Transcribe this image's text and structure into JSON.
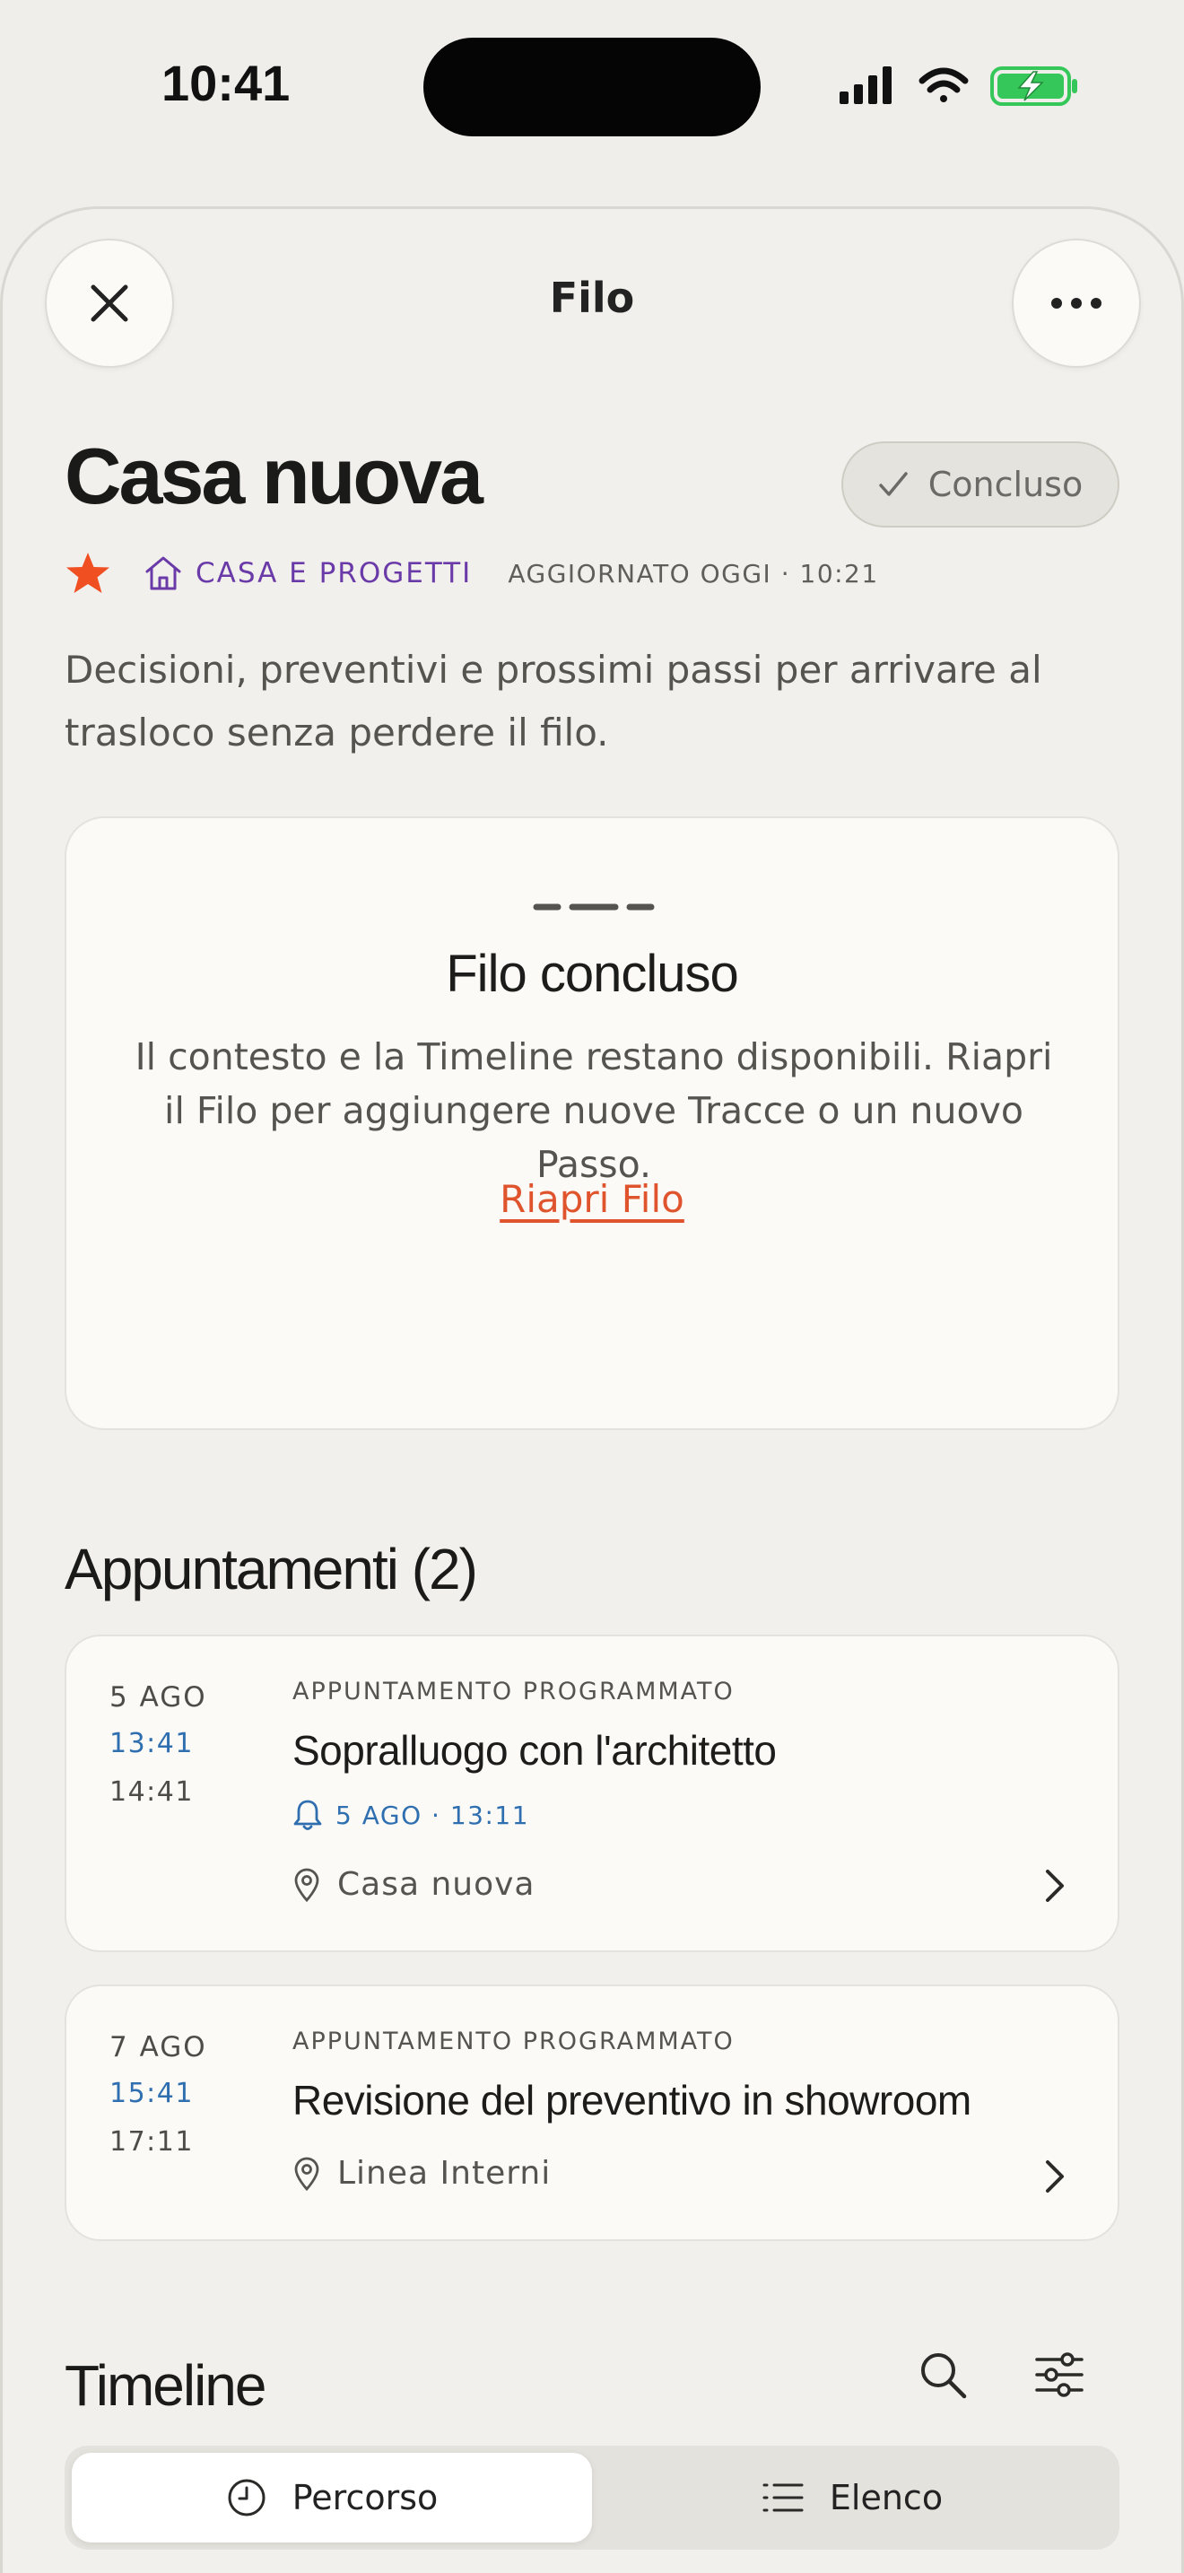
{
  "status_bar": {
    "time": "10:41"
  },
  "sheet": {
    "title": "Filo"
  },
  "thread": {
    "title": "Casa nuova",
    "status_label": "Concluso",
    "category": "CASA E PROGETTI",
    "updated": "AGGIORNATO OGGI · 10:21",
    "description": "Decisioni, preventivi e prossimi passi per arrivare al trasloco senza perdere il filo."
  },
  "closed_card": {
    "title": "Filo concluso",
    "text": "Il contesto e la Timeline restano disponibili. Riapri il Filo per aggiungere nuove Tracce o un nuovo Passo.",
    "reopen_label": "Riapri Filo"
  },
  "appointments": {
    "title": "Appuntamenti (2)",
    "items": [
      {
        "date": "5 AGO",
        "start": "13:41",
        "end": "14:41",
        "kind": "APPUNTAMENTO PROGRAMMATO",
        "title": "Sopralluogo con l'architetto",
        "reminder": "5 AGO · 13:11",
        "place": "Casa nuova"
      },
      {
        "date": "7 AGO",
        "start": "15:41",
        "end": "17:11",
        "kind": "APPUNTAMENTO PROGRAMMATO",
        "title": "Revisione del preventivo in showroom",
        "place": "Linea Interni"
      }
    ]
  },
  "timeline": {
    "title": "Timeline",
    "tabs": [
      {
        "label": "Percorso",
        "icon": "clock-icon",
        "active": true
      },
      {
        "label": "Elenco",
        "icon": "list-icon",
        "active": false
      }
    ]
  },
  "colors": {
    "accent": "#e0542d",
    "category": "#6a3aa8",
    "time_blue": "#2f6fb0",
    "background": "#efeeea",
    "card": "#fbfaf7",
    "battery": "#35c759"
  }
}
